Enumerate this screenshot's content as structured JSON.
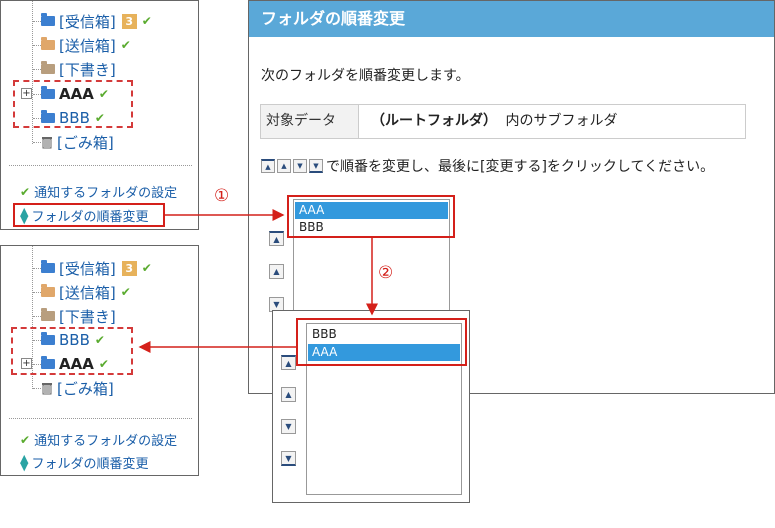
{
  "folders_before": [
    {
      "label": "[受信箱]",
      "badge": "3"
    },
    {
      "label": "[送信箱]"
    },
    {
      "label": "[下書き]"
    },
    {
      "label": "AAA"
    },
    {
      "label": "BBB"
    },
    {
      "label": "[ごみ箱]"
    }
  ],
  "folders_after": [
    {
      "label": "[受信箱]",
      "badge": "3"
    },
    {
      "label": "[送信箱]"
    },
    {
      "label": "[下書き]"
    },
    {
      "label": "BBB"
    },
    {
      "label": "AAA"
    },
    {
      "label": "[ごみ箱]"
    }
  ],
  "links": {
    "notify_folders": "通知するフォルダの設定",
    "reorder_folders": "フォルダの順番変更"
  },
  "dialog": {
    "title": "フォルダの順番変更",
    "intro": "次のフォルダを順番変更します。",
    "target_label": "対象データ",
    "target_value_bold": "（ルートフォルダ）",
    "target_value_rest": "内のサブフォルダ",
    "instruction": "で順番を変更し、最後に[変更する]をクリックしてください。"
  },
  "list_before": [
    "AAA",
    "BBB"
  ],
  "list_after": [
    "BBB",
    "AAA"
  ],
  "steps": {
    "step1": "①",
    "step2": "②"
  },
  "icons": {
    "move_top": "▲",
    "move_up": "▲",
    "move_down": "▼",
    "move_bottom": "▼",
    "check": "✔",
    "expand": "+"
  },
  "colors": {
    "title_bar": "#5aa8d8",
    "selection": "#3399dd",
    "annotation_red": "#d4201a",
    "check_green": "#5aab2f",
    "badge": "#e7b25b"
  }
}
